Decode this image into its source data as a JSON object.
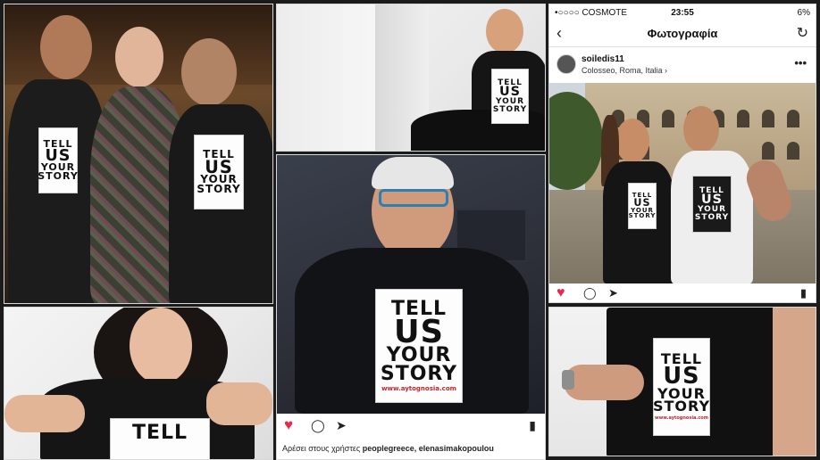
{
  "slogan": {
    "line1": "TELL",
    "line2": "US",
    "line3": "YOUR",
    "line4": "STORY",
    "url": "www.aytognosia.com"
  },
  "instagram_top": {
    "carrier": "•○○○○ COSMOTE",
    "time": "23:55",
    "battery": "6%",
    "title": "Φωτογραφία",
    "username": "soiledis11",
    "location": "Colosseo, Roma, Italia ›"
  },
  "instagram_center": {
    "likes_prefix": "Αρέσει στους χρήστες ",
    "likes_users": "peoplegreece, elenasimakopoulou"
  },
  "icons": {
    "back": "‹",
    "refresh": "↻",
    "more": "•••",
    "heart": "♥",
    "comment": "◯",
    "share": "➤",
    "bookmark": "▮"
  },
  "colors": {
    "heart": "#e8294a",
    "url": "#c0282d"
  }
}
